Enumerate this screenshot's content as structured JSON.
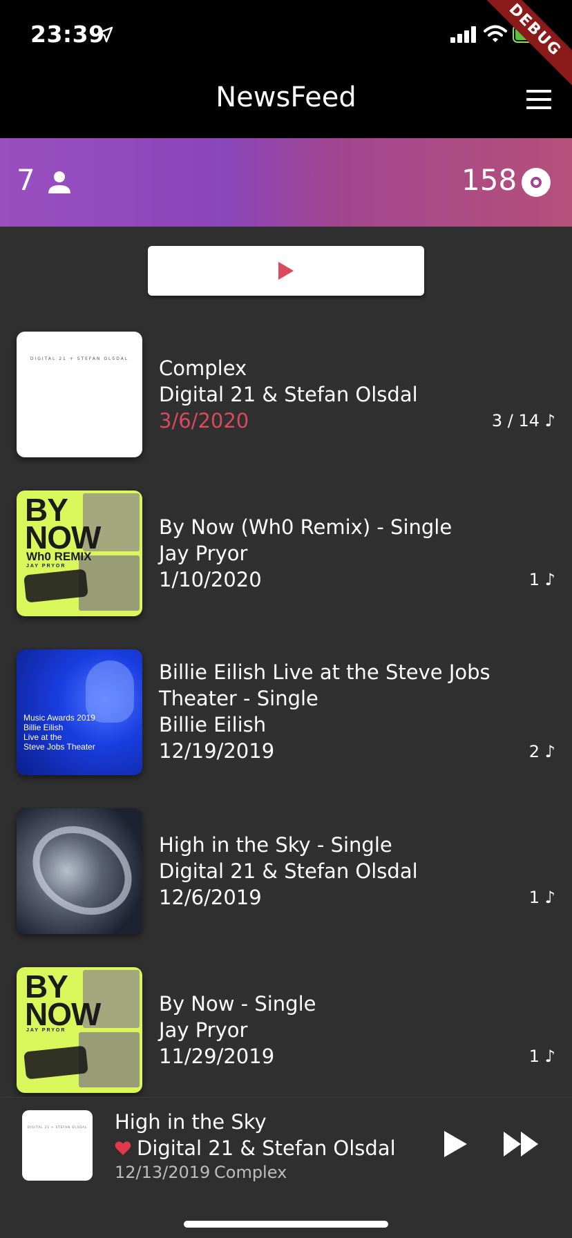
{
  "status": {
    "time": "23:39",
    "debug": "DEBUG"
  },
  "nav": {
    "title": "NewsFeed"
  },
  "stats": {
    "followers": "7",
    "releases": "158"
  },
  "feed": [
    {
      "title": "Complex",
      "artist": "Digital 21 & Stefan Olsdal",
      "date": "3/6/2020",
      "count": "3 / 14 ♪",
      "art_text": "DIGITAL 21 + STEFAN OLSDAL"
    },
    {
      "title": "By Now (Wh0 Remix) - Single",
      "artist": "Jay Pryor",
      "date": "1/10/2020",
      "count": "1 ♪",
      "art_big": "BY\nNOW",
      "art_sub1": "Wh0 REMIX",
      "art_sub2": "JAY PRYOR"
    },
    {
      "title": "Billie Eilish Live at the Steve Jobs Theater - Single",
      "artist": "Billie Eilish",
      "date": "12/19/2019",
      "count": "2 ♪",
      "art_text": "Music Awards 2019\nBillie Eilish\nLive at the\nSteve Jobs Theater"
    },
    {
      "title": "High in the Sky - Single",
      "artist": "Digital 21 & Stefan Olsdal",
      "date": "12/6/2019",
      "count": "1 ♪"
    },
    {
      "title": "By Now - Single",
      "artist": "Jay Pryor",
      "date": "11/29/2019",
      "count": "1 ♪",
      "art_big": "BY\nNOW",
      "art_sub2": "JAY PRYOR"
    }
  ],
  "player": {
    "title": "High in the Sky",
    "artist": "Digital 21 & Stefan Olsdal",
    "date": "12/13/2019",
    "album": "Complex",
    "art_text": "DIGITAL 21 + STEFAN OLSDAL"
  },
  "colors": {
    "accent": "#d94a5c",
    "background": "#303030"
  }
}
